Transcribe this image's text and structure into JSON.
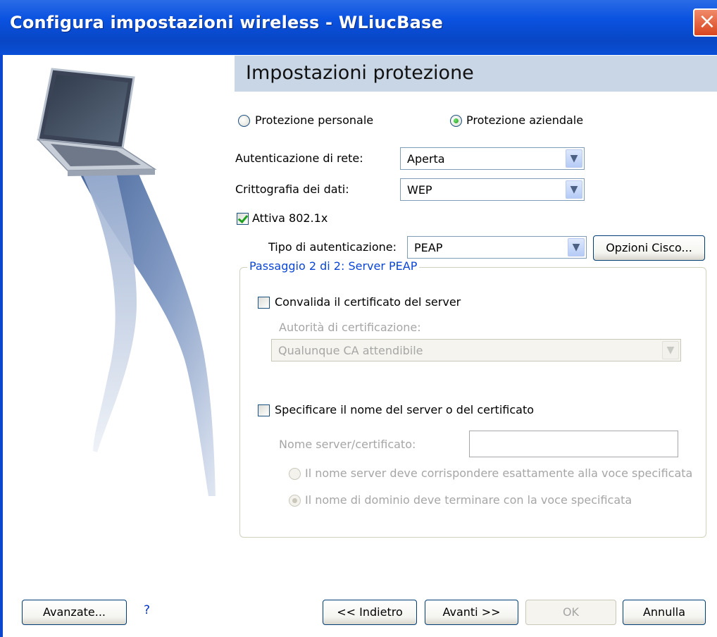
{
  "window": {
    "title": "Configura impostazioni wireless - WLiucBase",
    "close_glyph": "×"
  },
  "header": {
    "title": "Impostazioni protezione"
  },
  "protection_mode": {
    "personal_label": "Protezione personale",
    "enterprise_label": "Protezione aziendale",
    "selected": "enterprise"
  },
  "network_auth": {
    "label": "Autenticazione di rete:",
    "value": "Aperta"
  },
  "data_encryption": {
    "label": "Crittografia dei dati:",
    "value": "WEP"
  },
  "enable_8021x": {
    "label": "Attiva 802.1x",
    "checked": true
  },
  "auth_type": {
    "label": "Tipo di autenticazione:",
    "value": "PEAP",
    "cisco_button": "Opzioni Cisco..."
  },
  "peap_group": {
    "label": "Passaggio 2 di 2: Server PEAP",
    "validate_cert_label": "Convalida il certificato del server",
    "ca_label": "Autorità di certificazione:",
    "ca_value": "Qualunque CA attendibile",
    "specify_server_label": "Specificare il nome del server o del certificato",
    "server_name_label": "Nome server/certificato:",
    "server_name_value": "",
    "exact_match_label": "Il nome server deve corrispondere esattamente alla voce specificata",
    "domain_match_label": "Il nome di dominio deve terminare con la voce specificata"
  },
  "footer": {
    "advanced_button": "Avanzate...",
    "help_glyph": "?",
    "back_button": "<< Indietro",
    "next_button": "Avanti >>",
    "ok_button": "OK",
    "cancel_button": "Annulla"
  },
  "icons": {
    "dropdown": "chevron-down-icon",
    "help": "help-icon",
    "close": "close-icon"
  },
  "colors": {
    "title_bar": "#0a52e0",
    "section_header": "#c9d6e5",
    "group_label": "#0a46d5",
    "close_button": "#d8451f"
  }
}
